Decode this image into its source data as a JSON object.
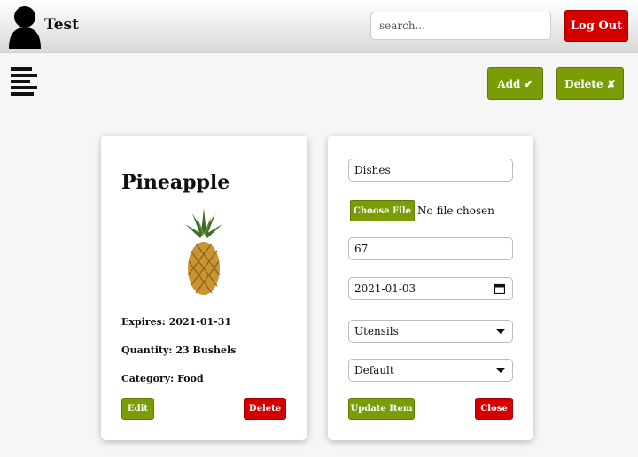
{
  "header": {
    "app_title": "Test",
    "search_placeholder": "search...",
    "logout_label": "Log Out"
  },
  "toolbar": {
    "add_label": "Add ✔",
    "delete_label": "Delete ✘"
  },
  "item_card": {
    "name": "Pineapple",
    "expires": "Expires: 2021-01-31",
    "quantity": "Quantity: 23 Bushels",
    "category": "Category: Food",
    "edit_label": "Edit",
    "delete_label": "Delete"
  },
  "edit_form": {
    "name_value": "Dishes",
    "choose_file_label": "Choose File",
    "file_status": "No file chosen",
    "quantity_value": "67",
    "date_value": "2021-01-03",
    "category_value": "Utensils",
    "unit_value": "Default",
    "update_label": "Update Item",
    "close_label": "Close"
  },
  "colors": {
    "accent_green": "#7a9c06",
    "danger_red": "#d40000"
  },
  "icons": [
    "user-avatar-icon",
    "hamburger-menu-icon",
    "calendar-icon",
    "dropdown-arrow-icon",
    "pineapple-image"
  ]
}
